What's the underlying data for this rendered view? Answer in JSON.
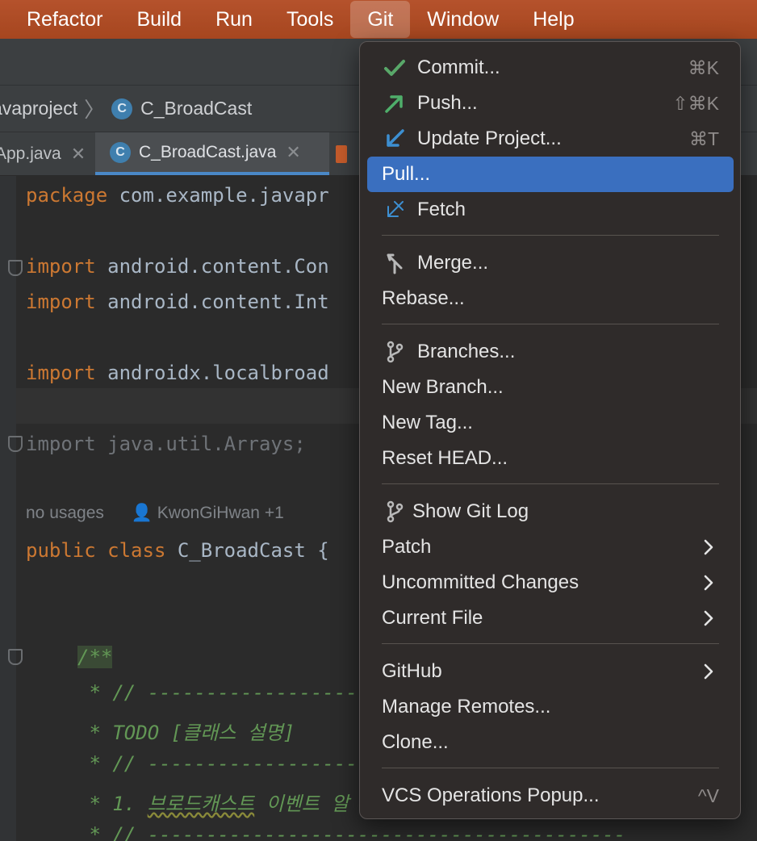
{
  "menubar": {
    "items": [
      "Refactor",
      "Build",
      "Run",
      "Tools",
      "Git",
      "Window",
      "Help"
    ]
  },
  "breadcrumb": {
    "project": "avaproject",
    "file": "C_BroadCast"
  },
  "tabs": {
    "first": "App.java",
    "active": "C_BroadCast.java"
  },
  "editor": {
    "lines": {
      "l1_kw": "package",
      "l1_rest": " com.example.javapr",
      "l2_kw": "import",
      "l2_rest": " android.content.Con",
      "l3_kw": "import",
      "l3_rest": " android.content.Int",
      "l4_kw": "import",
      "l4_rest": " androidx.localbroad",
      "l5": "import java.util.Arrays;",
      "l6_kw1": "public",
      "l6_kw2": "class",
      "l6_rest": " C_BroadCast {",
      "l7": "/**",
      "l8": " * // ------------------------",
      "l9": " * TODO [클래스 설명]",
      "l10": " * // ------------------------",
      "l11_a": " * 1. ",
      "l11_b": "브로드캐스트",
      "l11_c": " 이벤트 알",
      "l12": " * // -----------------------------------------"
    },
    "hint_usages": "no usages",
    "hint_author": "KwonGiHwan +1"
  },
  "git_menu": {
    "commit": {
      "label": "Commit...",
      "shortcut": "⌘K"
    },
    "push": {
      "label": "Push...",
      "shortcut": "⇧⌘K"
    },
    "update": {
      "label": "Update Project...",
      "shortcut": "⌘T"
    },
    "pull": {
      "label": "Pull..."
    },
    "fetch": {
      "label": "Fetch"
    },
    "merge": {
      "label": "Merge..."
    },
    "rebase": {
      "label": "Rebase..."
    },
    "branches": {
      "label": "Branches..."
    },
    "new_branch": {
      "label": "New Branch..."
    },
    "new_tag": {
      "label": "New Tag..."
    },
    "reset_head": {
      "label": "Reset HEAD..."
    },
    "show_log": {
      "label": "Show Git Log"
    },
    "patch": {
      "label": "Patch"
    },
    "uncommitted": {
      "label": "Uncommitted Changes"
    },
    "current_file": {
      "label": "Current File"
    },
    "github": {
      "label": "GitHub"
    },
    "manage_remotes": {
      "label": "Manage Remotes..."
    },
    "clone": {
      "label": "Clone..."
    },
    "vcs_popup": {
      "label": "VCS Operations Popup...",
      "shortcut": "^V"
    }
  },
  "colors": {
    "menubar": "#a6461f",
    "selection": "#3a6fbf",
    "commit_check": "#59a869",
    "push_arrow": "#4fae6a",
    "update_arrow": "#3d8fd1"
  }
}
